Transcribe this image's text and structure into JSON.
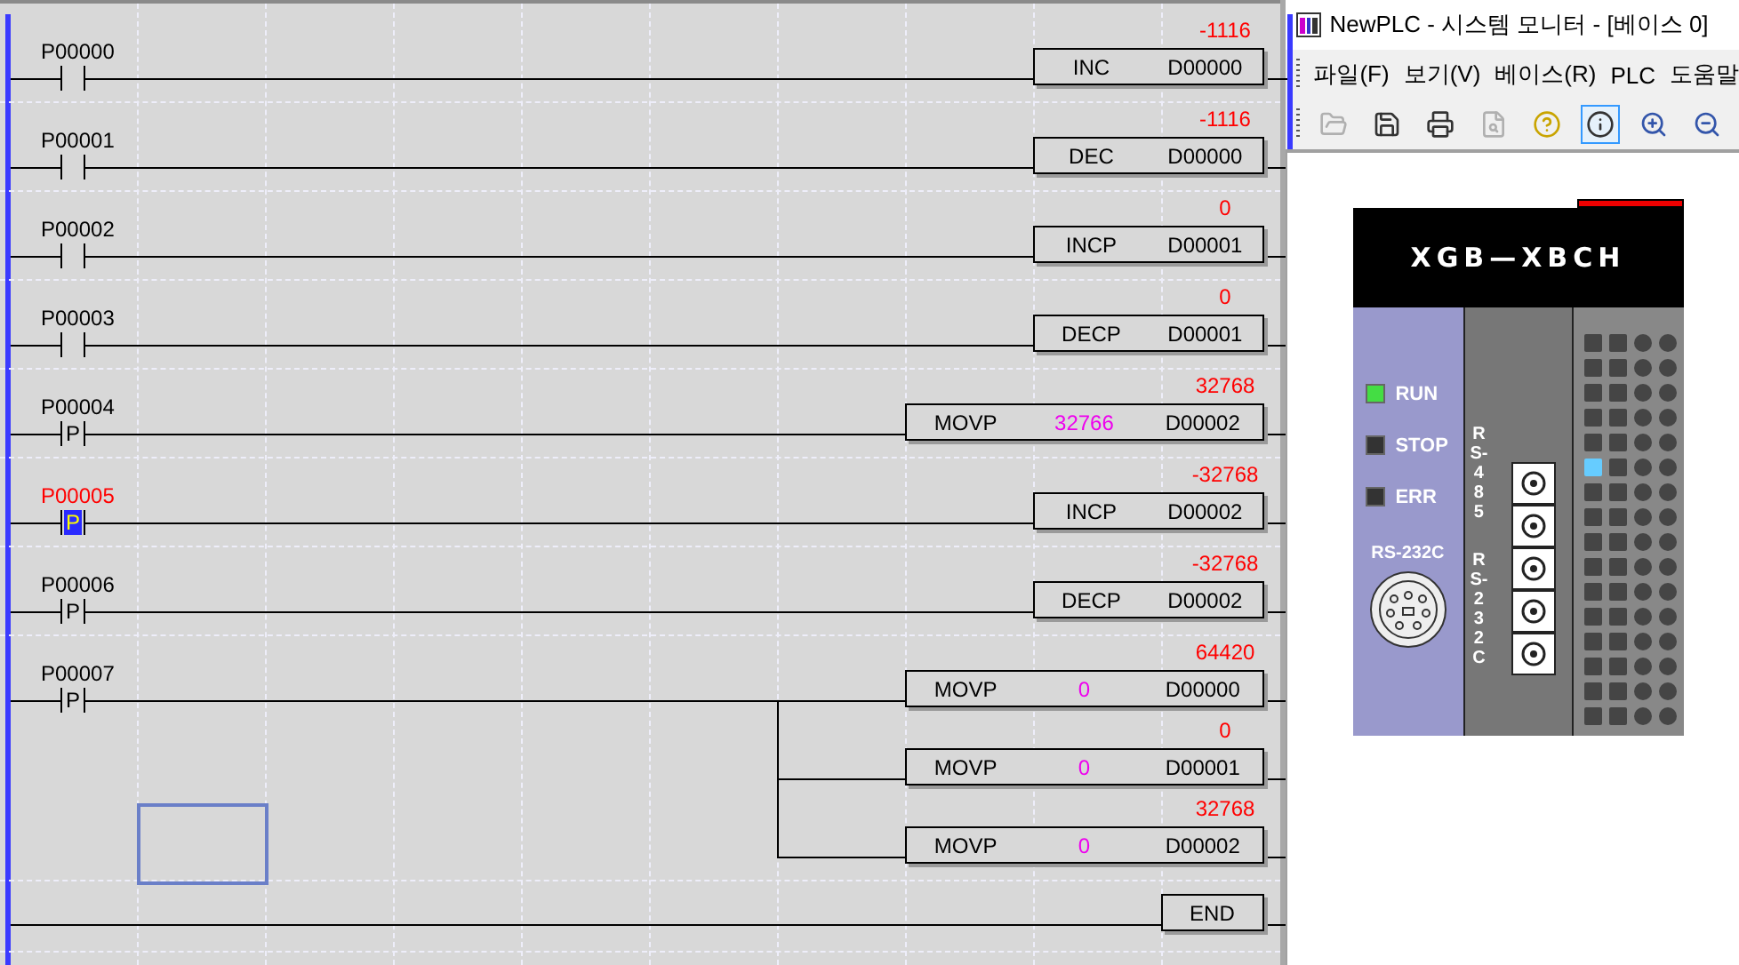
{
  "ladder": {
    "rungs": [
      {
        "contact": {
          "label": "P00000",
          "kind": "no",
          "active": false
        },
        "outputs": [
          {
            "op": "INC",
            "dest": "D00000",
            "value": "-1116"
          }
        ]
      },
      {
        "contact": {
          "label": "P00001",
          "kind": "no",
          "active": false
        },
        "outputs": [
          {
            "op": "DEC",
            "dest": "D00000",
            "value": "-1116"
          }
        ]
      },
      {
        "contact": {
          "label": "P00002",
          "kind": "no",
          "active": false
        },
        "outputs": [
          {
            "op": "INCP",
            "dest": "D00001",
            "value": "0"
          }
        ]
      },
      {
        "contact": {
          "label": "P00003",
          "kind": "no",
          "active": false
        },
        "outputs": [
          {
            "op": "DECP",
            "dest": "D00001",
            "value": "0"
          }
        ]
      },
      {
        "contact": {
          "label": "P00004",
          "kind": "pulse",
          "symbol": "P",
          "active": false
        },
        "outputs": [
          {
            "op": "MOVP",
            "source": "32766",
            "dest": "D00002",
            "value": "32768"
          }
        ]
      },
      {
        "contact": {
          "label": "P00005",
          "kind": "pulse",
          "symbol": "P",
          "active": true
        },
        "outputs": [
          {
            "op": "INCP",
            "dest": "D00002",
            "value": "-32768"
          }
        ]
      },
      {
        "contact": {
          "label": "P00006",
          "kind": "pulse",
          "symbol": "P",
          "active": false
        },
        "outputs": [
          {
            "op": "DECP",
            "dest": "D00002",
            "value": "-32768"
          }
        ]
      },
      {
        "contact": {
          "label": "P00007",
          "kind": "pulse",
          "symbol": "P",
          "active": false
        },
        "outputs": [
          {
            "op": "MOVP",
            "source": "0",
            "dest": "D00000",
            "value": "64420"
          },
          {
            "op": "MOVP",
            "source": "0",
            "dest": "D00001",
            "value": "0"
          },
          {
            "op": "MOVP",
            "source": "0",
            "dest": "D00002",
            "value": "32768"
          }
        ]
      }
    ],
    "end": "END",
    "cursor": true
  },
  "monitor": {
    "title": "NewPLC - 시스템 모니터 - [베이스 0]",
    "menu": [
      "파일(F)",
      "보기(V)",
      "베이스(R)",
      "PLC",
      "도움말"
    ],
    "toolbar": [
      {
        "kind": "open",
        "disabled": true,
        "pressed": false
      },
      {
        "kind": "save",
        "disabled": false,
        "pressed": false
      },
      {
        "kind": "print",
        "disabled": false,
        "pressed": false
      },
      {
        "kind": "preview",
        "disabled": true,
        "pressed": false
      },
      {
        "kind": "help",
        "disabled": false,
        "pressed": false
      },
      {
        "kind": "info",
        "disabled": false,
        "pressed": true
      },
      {
        "kind": "zoomin",
        "disabled": false,
        "pressed": false
      },
      {
        "kind": "zoomout",
        "disabled": false,
        "pressed": false
      }
    ],
    "plc": {
      "model": "XGB—XBCH",
      "leds": [
        {
          "label": "RUN",
          "on": true
        },
        {
          "label": "STOP",
          "on": false
        },
        {
          "label": "ERR",
          "on": false
        }
      ],
      "port_label": "RS-232C",
      "terminal_labels": [
        "RS-485",
        "RS-232C"
      ],
      "io_rows": [
        {
          "leds": [
            false,
            false,
            false,
            false
          ]
        },
        {
          "leds": [
            false,
            false,
            false,
            false
          ]
        },
        {
          "leds": [
            false,
            false,
            false,
            false
          ]
        },
        {
          "leds": [
            false,
            false,
            false,
            false
          ]
        },
        {
          "leds": [
            false,
            false,
            false,
            false
          ]
        },
        {
          "leds": [
            true,
            false,
            false,
            false
          ]
        },
        {
          "leds": [
            false,
            false,
            false,
            false
          ]
        },
        {
          "leds": [
            false,
            false,
            false,
            false
          ]
        },
        {
          "leds": [
            false,
            false,
            false,
            false
          ]
        },
        {
          "leds": [
            false,
            false,
            false,
            false
          ]
        },
        {
          "leds": [
            false,
            false,
            false,
            false
          ]
        },
        {
          "leds": [
            false,
            false,
            false,
            false
          ]
        },
        {
          "leds": [
            false,
            false,
            false,
            false
          ]
        },
        {
          "leds": [
            false,
            false,
            false,
            false
          ]
        },
        {
          "leds": [
            false,
            false,
            false,
            false
          ]
        },
        {
          "leds": [
            false,
            false,
            false,
            false
          ]
        }
      ]
    }
  }
}
